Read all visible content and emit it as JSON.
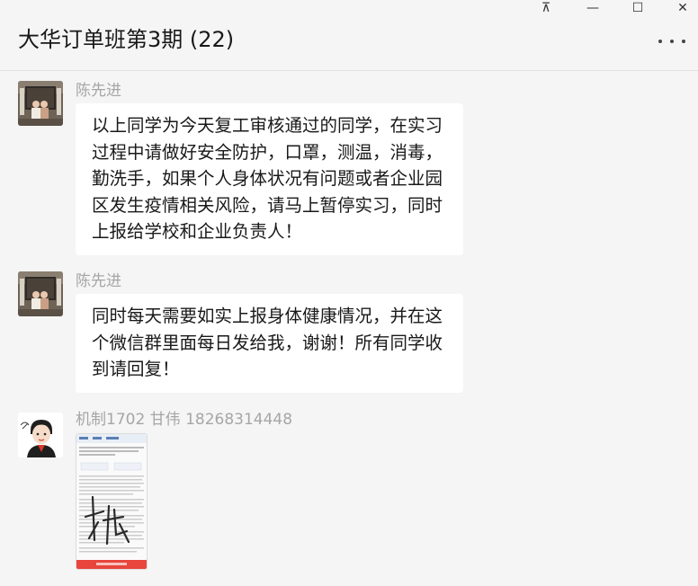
{
  "window": {
    "title": "大华订单班第3期 (22)",
    "pin_glyph": "⊼",
    "minimize_glyph": "—",
    "maximize_glyph": "☐",
    "close_glyph": "✕"
  },
  "messages": [
    {
      "sender": "陈先进",
      "text": "以上同学为今天复工审核通过的同学，在实习过程中请做好安全防护，口罩，测温，消毒，勤洗手，如果个人身体状况有问题或者企业园区发生疫情相关风险，请马上暂停实习，同时上报给学校和企业负责人！"
    },
    {
      "sender": "陈先进",
      "text": "同时每天需要如实上报身体健康情况，并在这个微信群里面每日发给我，谢谢！所有同学收到请回复！"
    },
    {
      "sender": "机制1702 甘伟 18268314448",
      "type": "image"
    }
  ],
  "colors": {
    "background": "#f5f5f5",
    "bubble": "#ffffff",
    "sender_name": "#a6a6a6",
    "text": "#191919"
  }
}
